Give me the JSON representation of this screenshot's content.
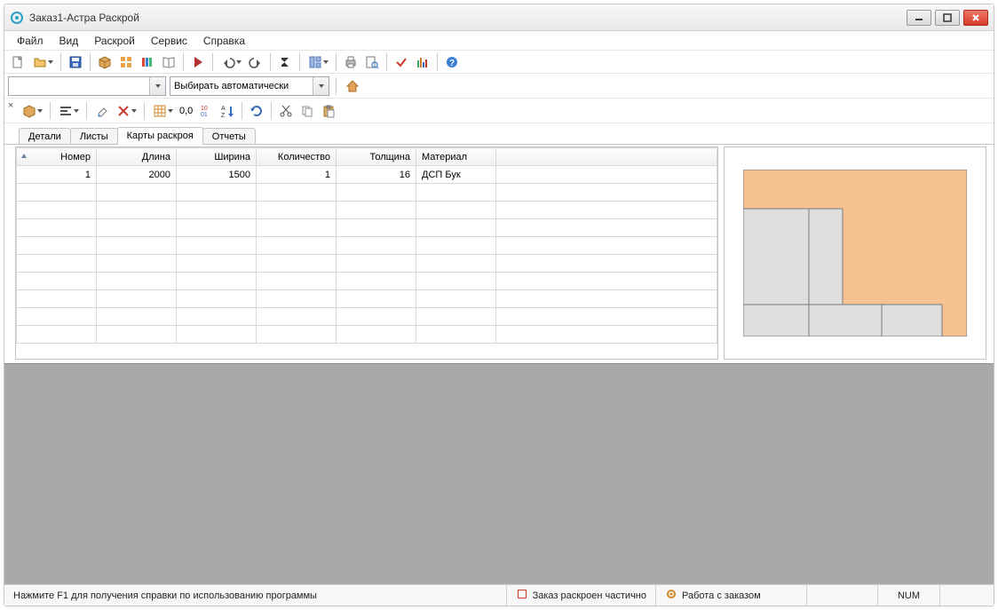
{
  "window": {
    "title": "Заказ1-Астра Раскрой"
  },
  "menu": {
    "items": [
      "Файл",
      "Вид",
      "Раскрой",
      "Сервис",
      "Справка"
    ]
  },
  "combos": {
    "c1": "",
    "c2": "Выбирать автоматически"
  },
  "toolbar3": {
    "precision_label": "0,0"
  },
  "tabs": {
    "items": [
      "Детали",
      "Листы",
      "Карты раскроя",
      "Отчеты"
    ],
    "active_index": 2
  },
  "table": {
    "columns": [
      "Номер",
      "Длина",
      "Ширина",
      "Количество",
      "Толщина",
      "Материал"
    ],
    "rows": [
      {
        "num": "1",
        "length": "2000",
        "width": "1500",
        "qty": "1",
        "thick": "16",
        "material": "ДСП Бук"
      }
    ]
  },
  "statusbar": {
    "hint": "Нажмите F1 для получения справки по использованию программы",
    "status1": "Заказ раскроен частично",
    "status2": "Работа с заказом",
    "indicator": "NUM"
  }
}
